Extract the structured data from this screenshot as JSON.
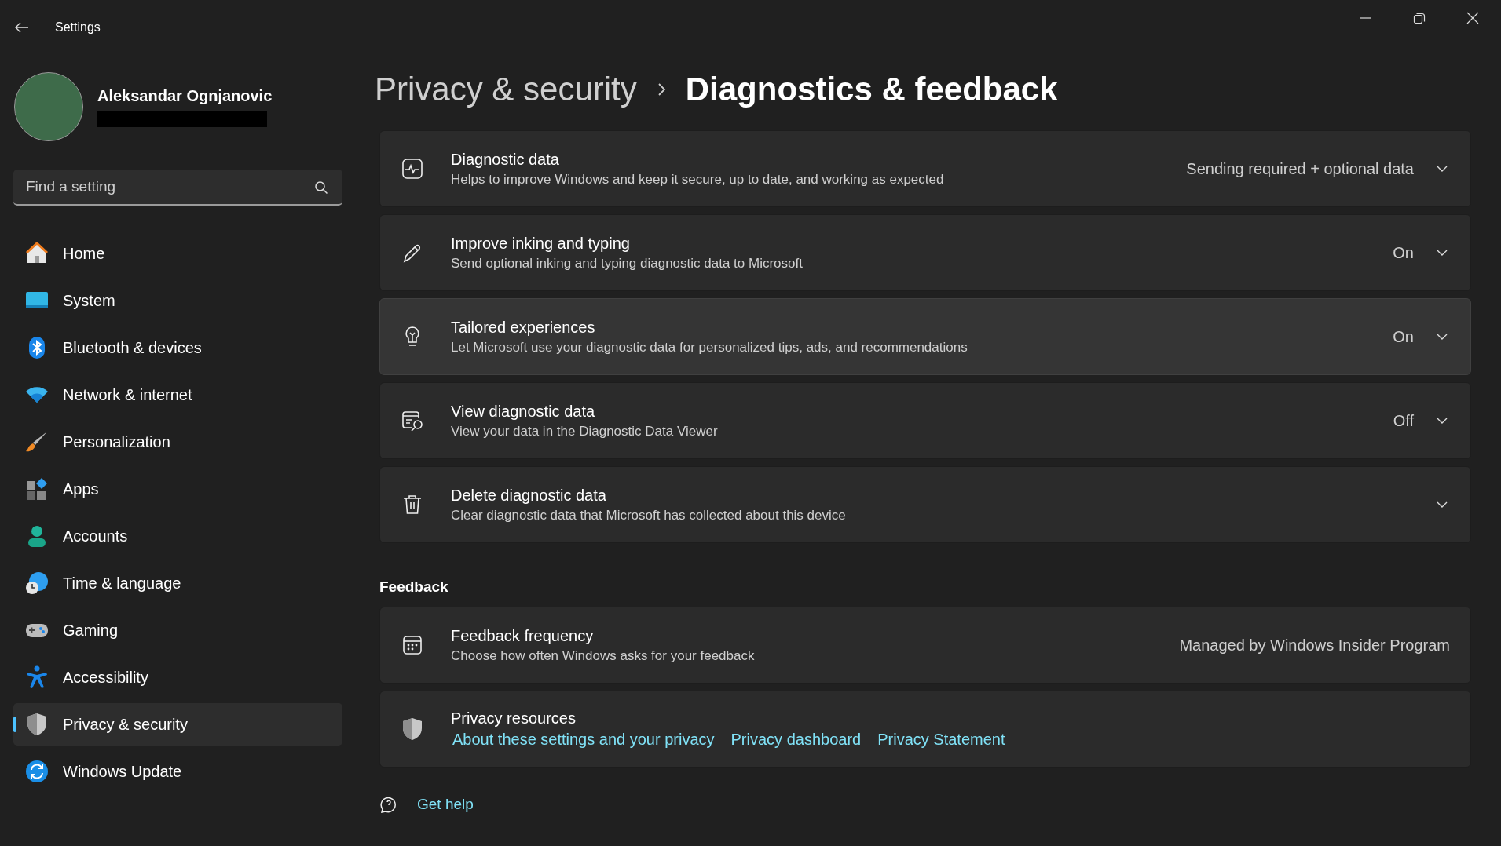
{
  "window": {
    "title": "Settings"
  },
  "profile": {
    "name": "Aleksandar Ognjanovic"
  },
  "search": {
    "placeholder": "Find a setting"
  },
  "nav": [
    {
      "label": "Home",
      "selected": false
    },
    {
      "label": "System",
      "selected": false
    },
    {
      "label": "Bluetooth & devices",
      "selected": false
    },
    {
      "label": "Network & internet",
      "selected": false
    },
    {
      "label": "Personalization",
      "selected": false
    },
    {
      "label": "Apps",
      "selected": false
    },
    {
      "label": "Accounts",
      "selected": false
    },
    {
      "label": "Time & language",
      "selected": false
    },
    {
      "label": "Gaming",
      "selected": false
    },
    {
      "label": "Accessibility",
      "selected": false
    },
    {
      "label": "Privacy & security",
      "selected": true
    },
    {
      "label": "Windows Update",
      "selected": false
    }
  ],
  "breadcrumb": {
    "parent": "Privacy & security",
    "current": "Diagnostics & feedback"
  },
  "diagnostics": [
    {
      "kind": "expander",
      "title": "Diagnostic data",
      "description": "Helps to improve Windows and keep it secure, up to date, and working as expected",
      "value": "Sending required + optional data",
      "highlighted": false
    },
    {
      "kind": "expander",
      "title": "Improve inking and typing",
      "description": "Send optional inking and typing diagnostic data to Microsoft",
      "value": "On",
      "highlighted": false
    },
    {
      "kind": "expander",
      "title": "Tailored experiences",
      "description": "Let Microsoft use your diagnostic data for personalized tips, ads, and recommendations",
      "value": "On",
      "highlighted": true
    },
    {
      "kind": "expander",
      "title": "View diagnostic data",
      "description": "View your data in the Diagnostic Data Viewer",
      "value": "Off",
      "highlighted": false
    },
    {
      "kind": "expander",
      "title": "Delete diagnostic data",
      "description": "Clear diagnostic data that Microsoft has collected about this device",
      "highlighted": false
    }
  ],
  "feedback": {
    "heading": "Feedback",
    "items": [
      {
        "kind": "info",
        "title": "Feedback frequency",
        "description": "Choose how often Windows asks for your feedback",
        "value": "Managed by Windows Insider Program"
      },
      {
        "kind": "links",
        "title": "Privacy resources",
        "links": [
          "About these settings and your privacy",
          "Privacy dashboard",
          "Privacy Statement"
        ]
      }
    ]
  },
  "help": {
    "label": "Get help"
  }
}
